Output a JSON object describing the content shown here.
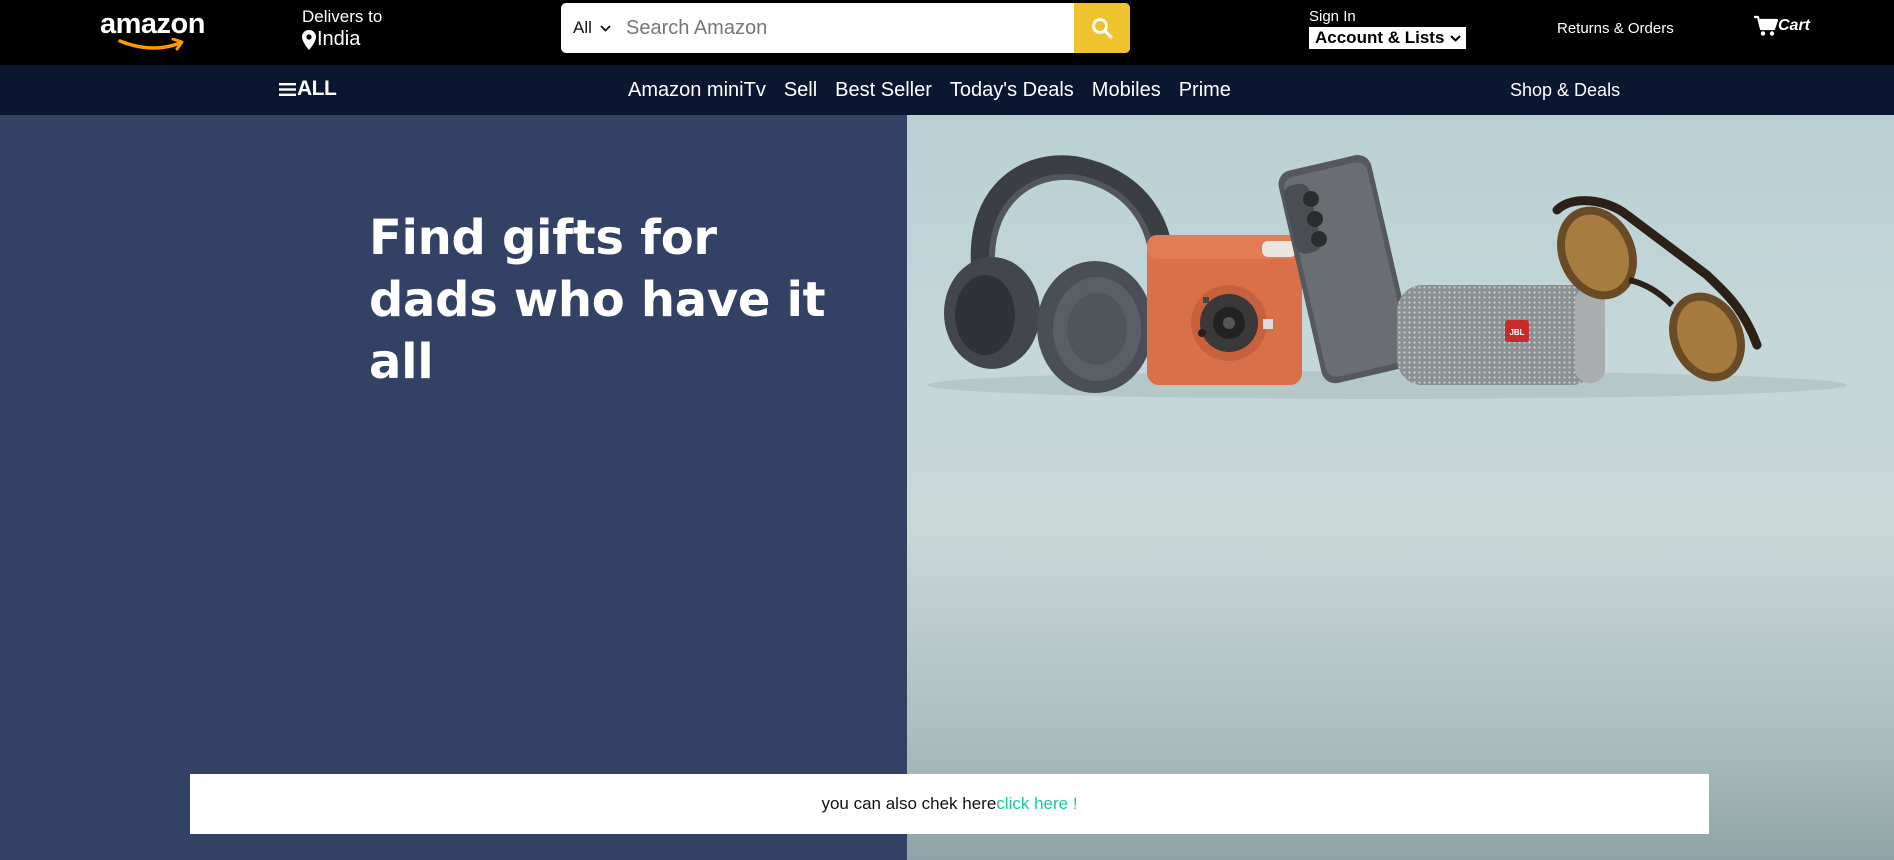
{
  "header": {
    "logo_text": "amazon",
    "deliver": {
      "line1": "Delivers to",
      "location": "India"
    },
    "search": {
      "category": "All",
      "placeholder": "Search Amazon"
    },
    "signin": {
      "small": "Sign In",
      "account": "Account & Lists"
    },
    "returns": "Returns & Orders",
    "cart": "Cart"
  },
  "subnav": {
    "all_label": "ALL",
    "links": [
      "Amazon miniTv",
      "Sell",
      "Best Seller",
      "Today's Deals",
      "Mobiles",
      "Prime"
    ],
    "right_label": "Shop & Deals"
  },
  "hero": {
    "title_line1": "Find gifts for",
    "title_line2": "dads who have it all",
    "products": [
      "headphones",
      "instant-camera",
      "smartphone",
      "bluetooth-speaker",
      "sunglasses"
    ],
    "speaker_brand": "JBL"
  },
  "notice": {
    "text": "you can also chek here",
    "link": "click here !"
  },
  "colors": {
    "topbar": "#000000",
    "subnav": "#0b1631",
    "hero_left": "#334165",
    "search_button": "#efc32e",
    "link_accent": "#1ac99b",
    "logo_smile": "#ff9900"
  }
}
